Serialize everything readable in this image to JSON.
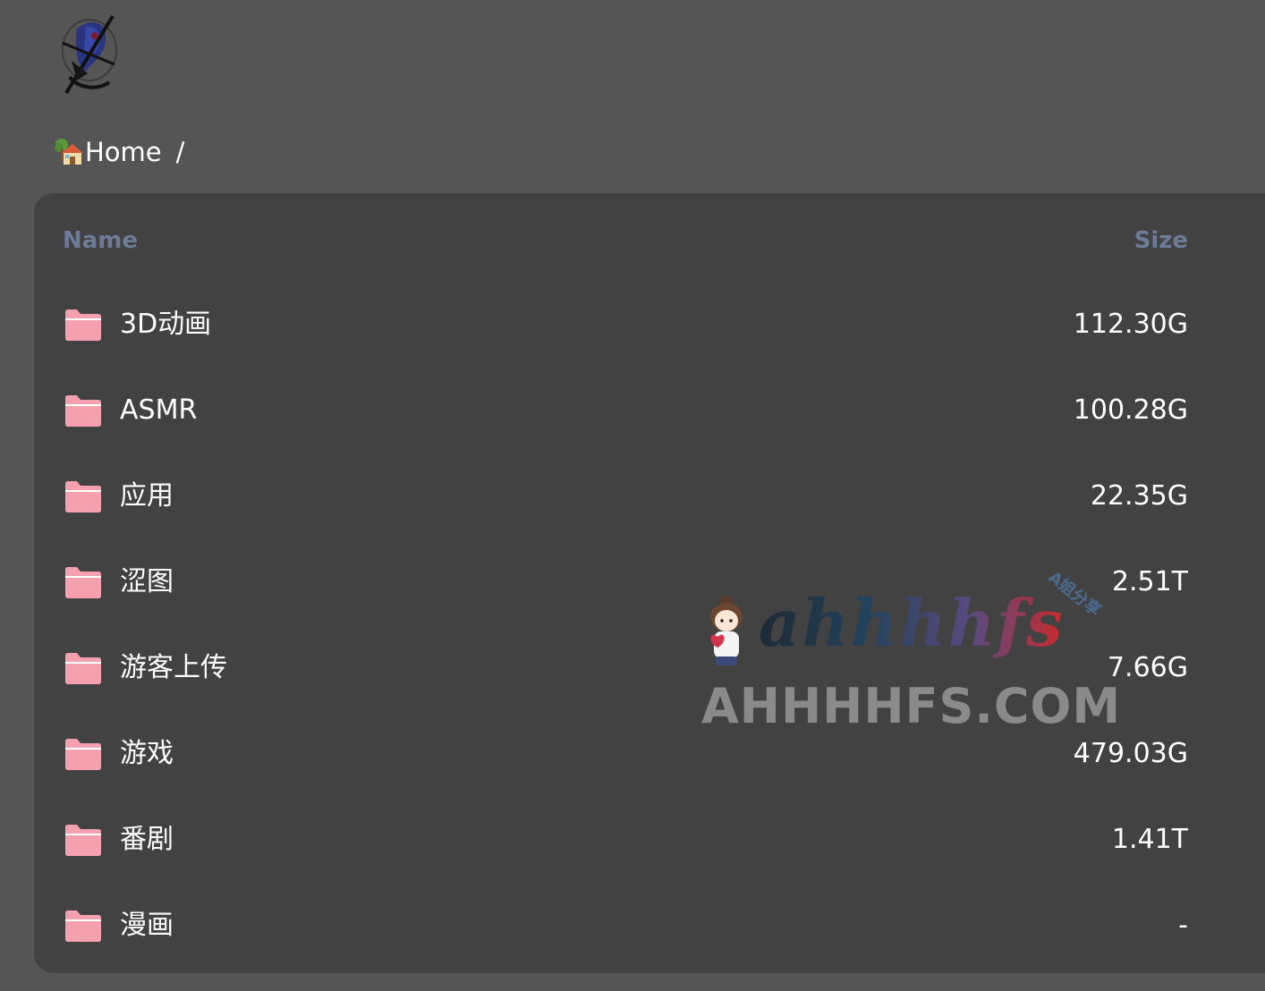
{
  "header": {
    "logo_name": "site-logo"
  },
  "breadcrumb": {
    "home_label": "Home",
    "separator": "/"
  },
  "table": {
    "columns": {
      "name": "Name",
      "size": "Size"
    },
    "rows": [
      {
        "name": "3D动画",
        "size": "112.30G",
        "icon": "folder-icon"
      },
      {
        "name": "ASMR",
        "size": "100.28G",
        "icon": "folder-icon"
      },
      {
        "name": "应用",
        "size": "22.35G",
        "icon": "folder-icon"
      },
      {
        "name": "涩图",
        "size": "2.51T",
        "icon": "folder-icon"
      },
      {
        "name": "游客上传",
        "size": "7.66G",
        "icon": "folder-icon"
      },
      {
        "name": "游戏",
        "size": "479.03G",
        "icon": "folder-icon"
      },
      {
        "name": "番剧",
        "size": "1.41T",
        "icon": "folder-icon"
      },
      {
        "name": "漫画",
        "size": "-",
        "icon": "folder-icon"
      }
    ]
  },
  "watermark": {
    "script": "ahhhhfs",
    "domain": "AHHHHFS.COM",
    "tag": "A姐分享"
  },
  "colors": {
    "page_bg": "#555555",
    "panel_bg": "#424242",
    "header_text": "#6c7c98",
    "folder": "#f4a0ae",
    "text": "#ffffff"
  }
}
